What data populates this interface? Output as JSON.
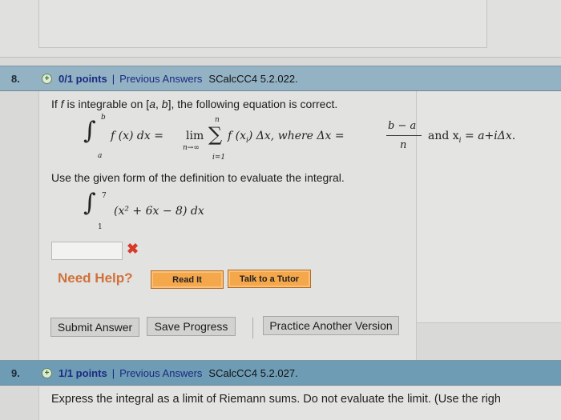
{
  "questions": [
    {
      "number": "8.",
      "points": "0/1 points",
      "separator": "|",
      "previous": "Previous Answers",
      "code": "SCalcCC4 5.2.022.",
      "intro_pre": "If ",
      "intro_f": "f",
      "intro_mid": " is integrable on [",
      "intro_a": "a",
      ",": ", ",
      "intro_b": "b",
      "intro_post": "], the following equation is correct.",
      "instruction": "Use the given form of the definition to evaluate the integral.",
      "answer_value": "",
      "answer_status": "incorrect"
    },
    {
      "number": "9.",
      "points": "1/1 points",
      "separator": "|",
      "previous": "Previous Answers",
      "code": "SCalcCC4 5.2.027.",
      "text": "Express the integral as a limit of Riemann sums. Do not evaluate the limit. (Use the righ"
    }
  ],
  "formula": {
    "int_upper": "b",
    "int_lower": "a",
    "integrand": "f (x) dx =",
    "lim": "lim",
    "lim_sub": "n→∞",
    "sum_upper": "n",
    "sum_lower": "i=1",
    "sum_body": "f (x",
    "sub_i": "i",
    "sum_tail": ") Δx, where Δx =",
    "frac_num": "b − a",
    "frac_den": "n",
    "and": "and x",
    "tail": " = a+iΔx."
  },
  "problem": {
    "upper": "7",
    "lower": "1",
    "integrand": "(x² + 6x − 8) dx"
  },
  "help": {
    "label": "Need Help?",
    "read_it": "Read It",
    "tutor": "Talk to a Tutor"
  },
  "actions": {
    "submit": "Submit Answer",
    "save": "Save Progress",
    "practice": "Practice Another Version"
  },
  "colors": {
    "header8": "#93b2c4",
    "header9": "#6e9cb5",
    "help": "#d0713a",
    "orange_button": "#f5a74c",
    "error": "#d83a2a"
  }
}
